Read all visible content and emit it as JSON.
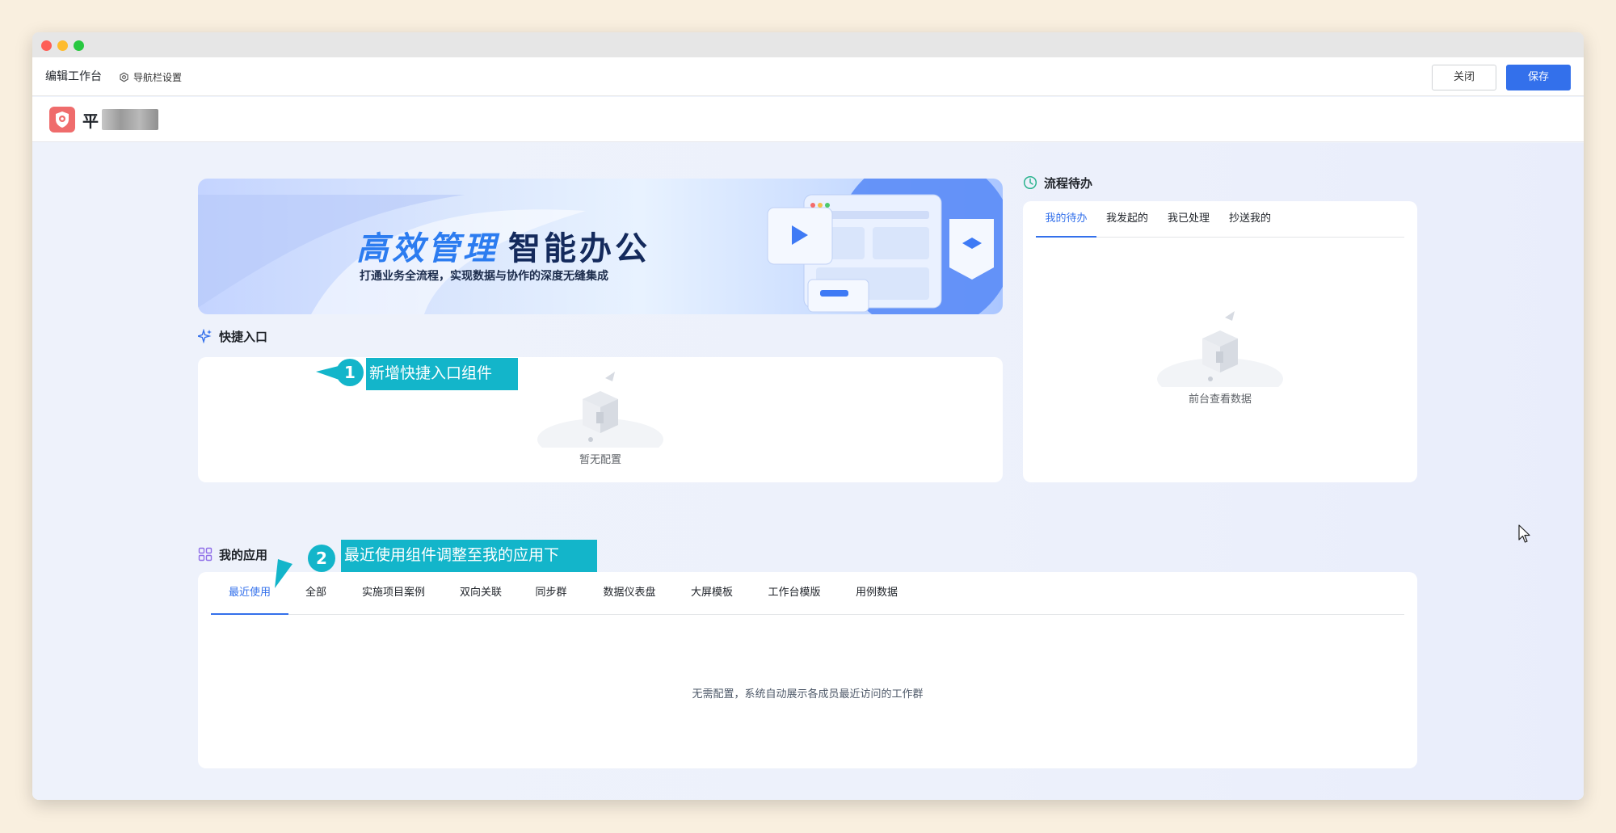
{
  "toolbar": {
    "title": "编辑工作台",
    "nav_settings": "导航栏设置",
    "close_label": "关闭",
    "save_label": "保存"
  },
  "header": {
    "org_name": "平"
  },
  "banner": {
    "title_a": "高效管理",
    "title_b": "智能办公",
    "subtitle": "打通业务全流程，实现数据与协作的深度无缝集成"
  },
  "quick_entry": {
    "title": "快捷入口",
    "empty_text": "暂无配置"
  },
  "workflow": {
    "title": "流程待办",
    "tabs": [
      "我的待办",
      "我发起的",
      "我已处理",
      "抄送我的"
    ],
    "active_tab": 0,
    "empty_text": "前台查看数据"
  },
  "my_apps": {
    "title": "我的应用",
    "tabs": [
      "最近使用",
      "全部",
      "实施项目案例",
      "双向关联",
      "同步群",
      "数据仪表盘",
      "大屏模板",
      "工作台模版",
      "用例数据"
    ],
    "active_tab": 0,
    "empty_text": "无需配置，系统自动展示各成员最近访问的工作群"
  },
  "annotations": [
    {
      "number": "1",
      "text": "新增快捷入口组件"
    },
    {
      "number": "2",
      "text": "最近使用组件调整至我的应用下"
    }
  ],
  "colors": {
    "primary": "#3370eb",
    "callout": "#13b5ca",
    "logo": "#ef6c6c"
  }
}
